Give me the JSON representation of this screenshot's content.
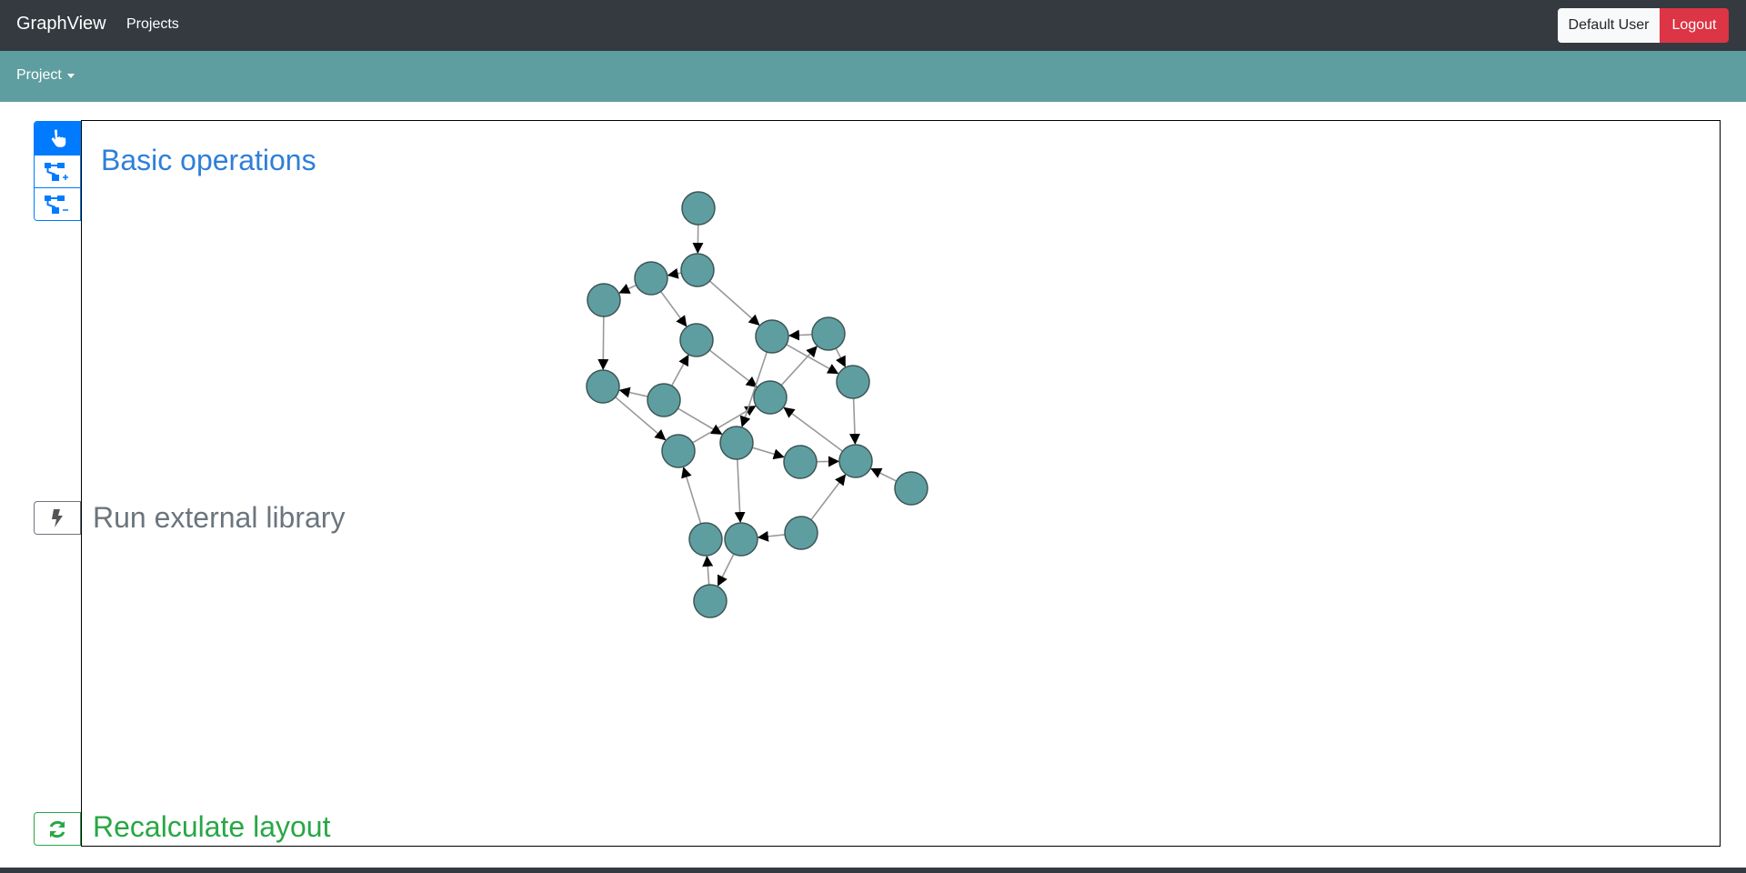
{
  "app": {
    "brand": "GraphView",
    "nav_projects": "Projects",
    "user_label": "Default User",
    "logout_label": "Logout"
  },
  "subnav": {
    "project_menu": "Project"
  },
  "tools": {
    "basic_operations": "Basic operations",
    "run_external_library": "Run external library",
    "recalculate_layout": "Recalculate layout",
    "items": [
      {
        "name": "pointer-tool",
        "icon": "hand-pointer-icon",
        "active": true
      },
      {
        "name": "add-node-tool",
        "icon": "sitemap-plus-icon",
        "active": false
      },
      {
        "name": "remove-node-tool",
        "icon": "sitemap-minus-icon",
        "active": false
      }
    ]
  },
  "colors": {
    "topbar": "#343a40",
    "subbar": "#5f9ea0",
    "node_fill": "#5f9ea0",
    "primary": "#007bff",
    "danger": "#dc3545",
    "success": "#28a745",
    "secondary": "#6c757d"
  }
}
